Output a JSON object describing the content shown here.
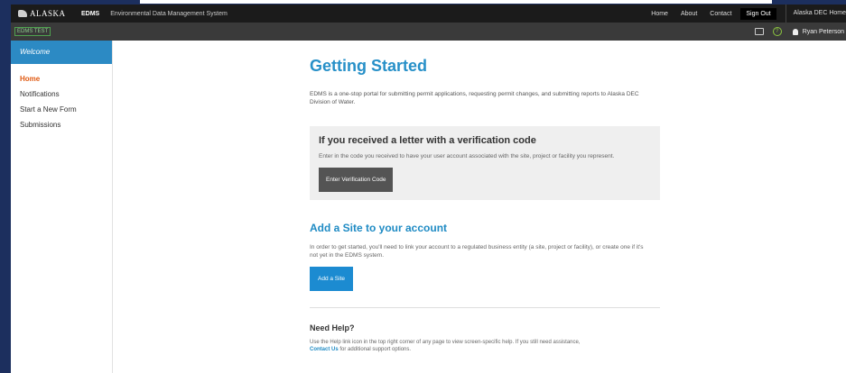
{
  "header": {
    "logo_text": "ALASKA",
    "brand": "EDMS",
    "system_name": "Environmental Data Management System",
    "nav": [
      "Home",
      "About",
      "Contact"
    ],
    "sign_out": "Sign Out",
    "dec_home": "Alaska DEC Home"
  },
  "subbar": {
    "env_badge": "EDMS TEST",
    "help_glyph": "?",
    "user_name": "Ryan Peterson"
  },
  "sidebar": {
    "welcome": "Welcome",
    "items": [
      "Home",
      "Notifications",
      "Start a New Form",
      "Submissions"
    ]
  },
  "main": {
    "title": "Getting Started",
    "intro": "EDMS is a one-stop portal for submitting permit applications, requesting permit changes, and submitting reports to Alaska DEC Division of Water.",
    "verify_title": "If you received a letter with a verification code",
    "verify_text": "Enter in the code you received to have your user account associated with the site, project or facility you represent.",
    "verify_button": "Enter Verification Code",
    "site_title": "Add a Site to your account",
    "site_text": "In order to get started, you'll need to link your account to a regulated business entity (a site, project or facility), or create one if it's not yet in the EDMS system.",
    "site_button": "Add a Site",
    "help_title": "Need Help?",
    "help_text_before": "Use the Help link icon in the top right corner of any page to view screen-specific help. If you still need assistance,",
    "contact_link": "Contact Us",
    "help_text_after": "for additional support options."
  },
  "colors": {
    "accent_blue": "#2790c8",
    "active_orange": "#e05a12",
    "page_bg": "#1c2f5e"
  }
}
